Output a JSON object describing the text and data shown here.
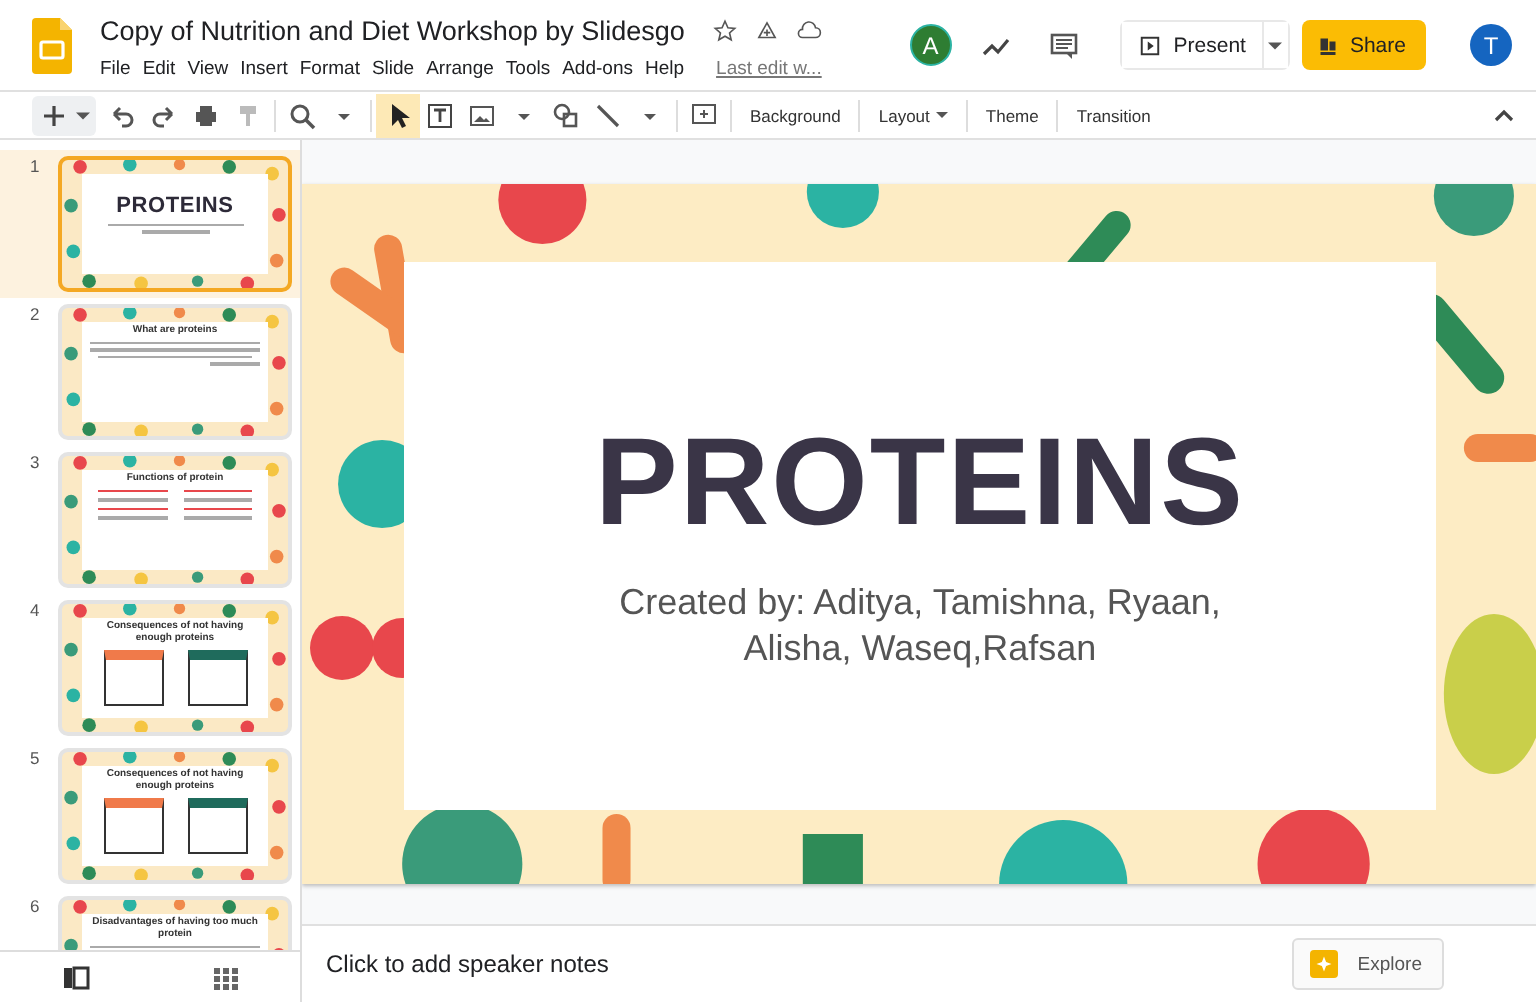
{
  "app": {
    "title": "Copy of Nutrition and Diet Workshop by Slidesgo",
    "menu": [
      "File",
      "Edit",
      "View",
      "Insert",
      "Format",
      "Slide",
      "Arrange",
      "Tools",
      "Add-ons",
      "Help"
    ],
    "last_edit": "Last edit w...",
    "collaborator_initial": "A",
    "present_label": "Present",
    "share_label": "Share",
    "account_initial": "T"
  },
  "toolbar": {
    "buttons": [
      {
        "label": "Background",
        "dropdown": false
      },
      {
        "label": "Layout",
        "dropdown": true
      },
      {
        "label": "Theme",
        "dropdown": false
      },
      {
        "label": "Transition",
        "dropdown": false
      }
    ]
  },
  "slides": [
    {
      "number": "1",
      "selected": true,
      "kind": "title",
      "title": "PROTEINS"
    },
    {
      "number": "2",
      "selected": false,
      "kind": "text",
      "title": "What are proteins"
    },
    {
      "number": "3",
      "selected": false,
      "kind": "grid",
      "title": "Functions of protein"
    },
    {
      "number": "4",
      "selected": false,
      "kind": "boxes",
      "title": "Consequences of not having enough proteins"
    },
    {
      "number": "5",
      "selected": false,
      "kind": "boxes",
      "title": "Consequences of not having enough proteins"
    },
    {
      "number": "6",
      "selected": false,
      "kind": "text",
      "title": "Disadvantages of having too much protein"
    }
  ],
  "current_slide": {
    "title": "PROTEINS",
    "subtitle": "Created by: Aditya, Tamishna,  Ryaan, Alisha, Waseq,Rafsan"
  },
  "speaker_notes": {
    "placeholder": "Click to add speaker notes"
  },
  "explore_label": "Explore"
}
